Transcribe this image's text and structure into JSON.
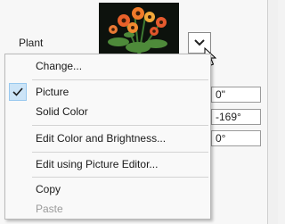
{
  "panel": {
    "plant_label": "Plant",
    "fields": [
      "0\"",
      "-169°",
      "0°"
    ]
  },
  "menu": {
    "items": [
      {
        "label": "Change...",
        "checked": false,
        "enabled": true
      },
      {
        "label": "Picture",
        "checked": true,
        "enabled": true
      },
      {
        "label": "Solid Color",
        "checked": false,
        "enabled": true
      },
      {
        "label": "Edit Color and Brightness...",
        "checked": false,
        "enabled": true
      },
      {
        "label": "Edit using Picture Editor...",
        "checked": false,
        "enabled": true
      },
      {
        "label": "Copy",
        "checked": false,
        "enabled": true
      },
      {
        "label": "Paste",
        "checked": false,
        "enabled": false
      }
    ]
  },
  "colors": {
    "check_highlight": "#cce4f7",
    "disabled_text": "#9a9a9a"
  }
}
